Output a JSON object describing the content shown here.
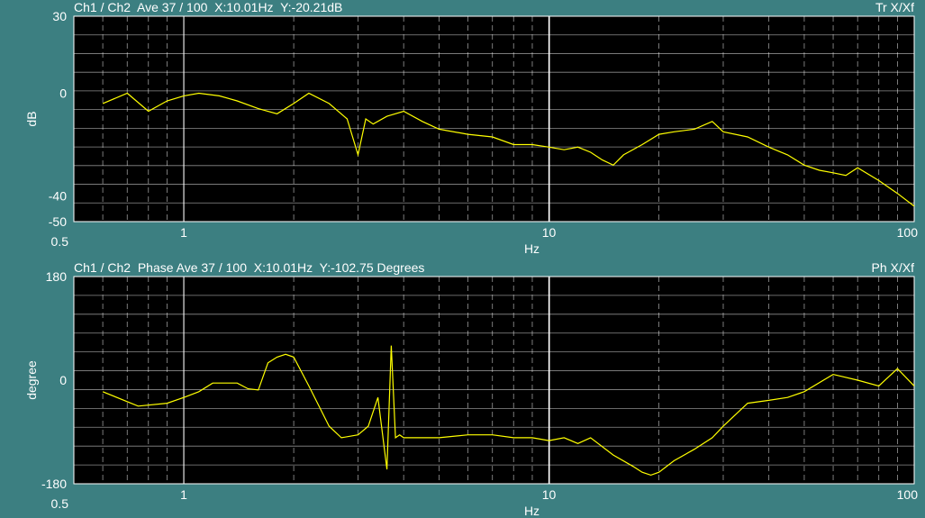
{
  "colors": {
    "background": "#3c7f81",
    "plot": "#000000",
    "grid": "#ffffff",
    "trace": "#ffff00",
    "text": "#ffffff"
  },
  "panels": [
    {
      "header_left": "Ch1 / Ch2  Ave 37 / 100  X:10.01Hz  Y:-20.21dB",
      "header_right": "Tr X/Xf",
      "ylabel": "dB",
      "xlabel": "Hz",
      "yticks": [
        "30",
        "0",
        "-40",
        "-50"
      ],
      "xticks": [
        "0.5",
        "1",
        "10",
        "100"
      ]
    },
    {
      "header_left": "Ch1 / Ch2  Phase Ave 37 / 100  X:10.01Hz  Y:-102.75 Degrees",
      "header_right": "Ph X/Xf",
      "ylabel": "degree",
      "xlabel": "Hz",
      "yticks": [
        "180",
        "0",
        "-180"
      ],
      "xticks": [
        "0.5",
        "1",
        "10",
        "100"
      ]
    }
  ],
  "chart_data": [
    {
      "type": "line",
      "title": "Ch1 / Ch2  Ave 37 / 100  X:10.01Hz  Y:-20.21dB",
      "xlabel": "Hz",
      "ylabel": "dB",
      "x_scale": "log",
      "xlim": [
        0.5,
        100
      ],
      "ylim": [
        -50,
        30
      ],
      "grid": true,
      "cursor": {
        "x": 10.01,
        "y": -20.21
      },
      "series": [
        {
          "x": [
            0.6,
            0.7,
            0.8,
            0.9,
            1.0,
            1.1,
            1.25,
            1.4,
            1.6,
            1.8,
            2.0,
            2.2,
            2.5,
            2.8,
            3.0,
            3.15,
            3.3,
            3.6,
            4.0,
            4.5,
            5.0,
            6.0,
            7.0,
            8.0,
            9.0,
            10.0,
            11.0,
            12.0,
            13.0,
            14.0,
            15.0,
            16.0,
            18.0,
            20.0,
            22.0,
            25.0,
            28.0,
            30.0,
            35.0,
            40.0,
            45.0,
            50.0,
            55.0,
            60.0,
            65.0,
            70.0,
            80.0,
            90.0,
            100.0
          ],
          "values": [
            -4,
            0,
            -7,
            -3,
            -1,
            0,
            -1,
            -3,
            -6,
            -8,
            -4,
            0,
            -4,
            -10,
            -24,
            -10,
            -12,
            -9,
            -7,
            -11,
            -14,
            -16,
            -17,
            -20,
            -20,
            -21,
            -22,
            -21,
            -23,
            -26,
            -28,
            -24,
            -20,
            -16,
            -15,
            -14,
            -11,
            -15,
            -17,
            -21,
            -24,
            -28,
            -30,
            -31,
            -32,
            -29,
            -34,
            -39,
            -44
          ]
        }
      ]
    },
    {
      "type": "line",
      "title": "Ch1 / Ch2  Phase Ave 37 / 100  X:10.01Hz  Y:-102.75 Degrees",
      "xlabel": "Hz",
      "ylabel": "degree",
      "x_scale": "log",
      "xlim": [
        0.5,
        100
      ],
      "ylim": [
        -180,
        180
      ],
      "grid": true,
      "cursor": {
        "x": 10.01,
        "y": -102.75
      },
      "series": [
        {
          "x": [
            0.6,
            0.75,
            0.9,
            1.0,
            1.1,
            1.2,
            1.4,
            1.5,
            1.6,
            1.7,
            1.8,
            1.9,
            2.0,
            2.2,
            2.5,
            2.7,
            3.0,
            3.2,
            3.4,
            3.6,
            3.7,
            3.8,
            3.9,
            4.0,
            5.0,
            6.0,
            7.0,
            8.0,
            9.0,
            10.0,
            11.0,
            12.0,
            13.0,
            15.0,
            17.0,
            18.0,
            19.0,
            20.0,
            22.0,
            25.0,
            28.0,
            30.0,
            35.0,
            40.0,
            45.0,
            50.0,
            60.0,
            70.0,
            80.0,
            90.0,
            100.0
          ],
          "values": [
            -20,
            -45,
            -40,
            -30,
            -20,
            -5,
            -5,
            -15,
            -17,
            30,
            40,
            45,
            40,
            -10,
            -80,
            -100,
            -95,
            -80,
            -30,
            -155,
            60,
            -100,
            -95,
            -100,
            -100,
            -95,
            -95,
            -100,
            -100,
            -105,
            -100,
            -110,
            -100,
            -130,
            -150,
            -160,
            -165,
            -160,
            -140,
            -120,
            -100,
            -80,
            -40,
            -35,
            -30,
            -20,
            10,
            0,
            -10,
            20,
            -10
          ]
        }
      ]
    }
  ]
}
